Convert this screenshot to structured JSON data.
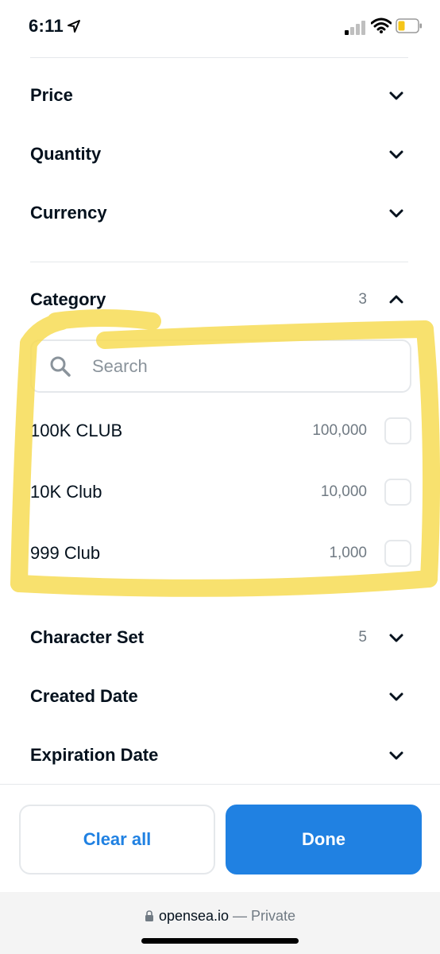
{
  "status": {
    "time": "6:11",
    "signal_icon": "cellular-signal-icon",
    "wifi_icon": "wifi-icon",
    "battery_icon": "battery-icon",
    "battery_color": "#f5c518"
  },
  "filters_top": [
    {
      "label": "Price",
      "expanded": false
    },
    {
      "label": "Quantity",
      "expanded": false
    },
    {
      "label": "Currency",
      "expanded": false
    }
  ],
  "category": {
    "label": "Category",
    "count": "3",
    "expanded": true,
    "search": {
      "placeholder": "Search",
      "value": ""
    },
    "items": [
      {
        "name": "100K CLUB",
        "count": "100,000",
        "checked": false
      },
      {
        "name": "10K Club",
        "count": "10,000",
        "checked": false
      },
      {
        "name": "999 Club",
        "count": "1,000",
        "checked": false
      }
    ]
  },
  "filters_bottom": [
    {
      "label": "Character Set",
      "count": "5",
      "expanded": false
    },
    {
      "label": "Created Date",
      "count": "",
      "expanded": false
    },
    {
      "label": "Expiration Date",
      "count": "",
      "expanded": false
    }
  ],
  "actions": {
    "clear_label": "Clear all",
    "done_label": "Done"
  },
  "browser": {
    "domain": "opensea.io",
    "mode": "— Private"
  },
  "colors": {
    "accent": "#2081e2",
    "highlight": "#f7dc55",
    "text": "#04111d",
    "muted": "#707a83",
    "border": "#e5e8eb"
  }
}
